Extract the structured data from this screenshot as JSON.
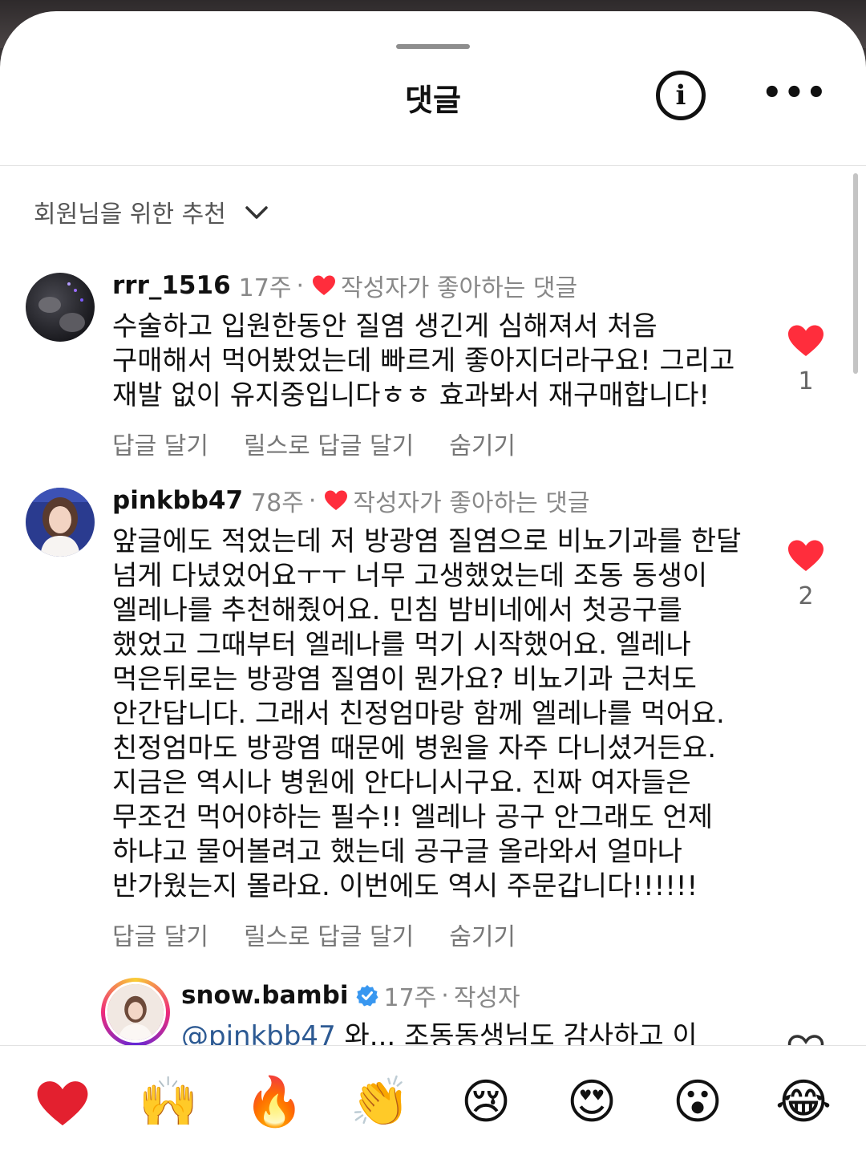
{
  "header": {
    "title": "댓글",
    "info_icon": "info-icon",
    "more_icon": "more-icon"
  },
  "sort": {
    "label": "회원님을 위한 추천"
  },
  "comments": [
    {
      "username": "rrr_1516",
      "time": "17주",
      "badge": "작성자가 좋아하는 댓글",
      "text": "수술하고 입원한동안 질염 생긴게 심해져서 처음 구매해서 먹어봤었는데 빠르게 좋아지더라구요! 그리고 재발 없이 유지중입니다ㅎㅎ 효과봐서 재구매합니다!",
      "likes": "1",
      "actions": [
        "답글 달기",
        "릴스로 답글 달기",
        "숨기기"
      ]
    },
    {
      "username": "pinkbb47",
      "time": "78주",
      "badge": "작성자가 좋아하는 댓글",
      "text": "앞글에도 적었는데 저 방광염 질염으로 비뇨기과를 한달 넘게 다녔었어요ㅜㅜ 너무 고생했었는데 조동 동생이 엘레나를 추천해줬어요. 민침 밤비네에서 첫공구를 했었고 그때부터 엘레나를 먹기 시작했어요. 엘레나 먹은뒤로는 방광염 질염이 뭔가요? 비뇨기과 근처도 안간답니다. 그래서 친정엄마랑 함께 엘레나를 먹어요. 친정엄마도 방광염 때문에 병원을 자주 다니셨거든요. 지금은 역시나 병원에 안다니시구요. 진짜 여자들은 무조건 먹어야하는 필수!! 엘레나 공구 안그래도 언제 하냐고 물어볼려고 했는데 공구글 올라와서 얼마나 반가웠는지 몰라요. 이번에도 역시 주문갑니다!!!!!!",
      "likes": "2",
      "actions": [
        "답글 달기",
        "릴스로 답글 달기",
        "숨기기"
      ]
    },
    {
      "username": "snow.bambi",
      "time": "17주",
      "author_label": "작성자",
      "mention": "@pinkbb47",
      "text": " 와... 조동동생님도 감사하고 이"
    }
  ],
  "reactions": [
    "❤️",
    "🙌",
    "🔥",
    "👏",
    "😢",
    "😍",
    "😮",
    "😂"
  ],
  "colors": {
    "heart": "#ff2d3c",
    "verified": "#3897f0",
    "mention": "#2d5a93"
  }
}
